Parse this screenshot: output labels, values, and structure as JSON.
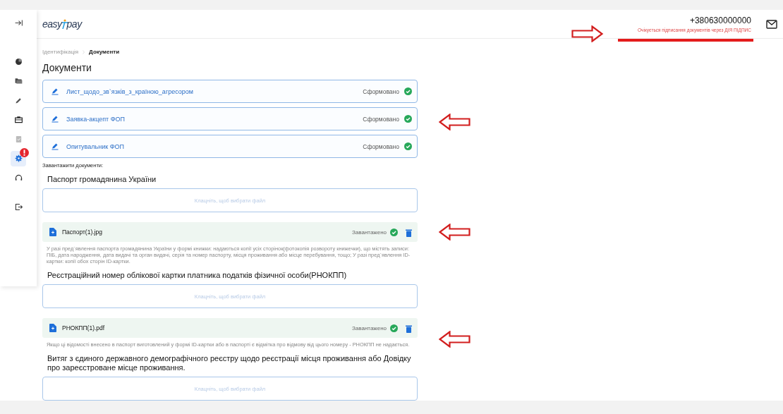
{
  "sidebar": {
    "items": [
      {
        "kind": "collapse",
        "selected": false,
        "alert": false
      },
      {
        "kind": "chart",
        "selected": false,
        "alert": false
      },
      {
        "kind": "folders",
        "selected": false,
        "alert": false
      },
      {
        "kind": "pen",
        "selected": false,
        "alert": false
      },
      {
        "kind": "briefcase",
        "selected": false,
        "alert": false
      },
      {
        "kind": "clipboard",
        "selected": false,
        "alert": false
      },
      {
        "kind": "gear",
        "selected": true,
        "alert": true
      },
      {
        "kind": "headset",
        "selected": false,
        "alert": false
      },
      {
        "kind": "logout",
        "selected": false,
        "alert": false
      }
    ]
  },
  "header": {
    "logo": [
      "easy",
      "pay"
    ],
    "phone": "+380630000000",
    "notice": "Очікується підписання документів через ДІЯ ПІДПИС"
  },
  "breadcrumbs": [
    {
      "label": "Ідентифікація",
      "selected": false
    },
    {
      "label": "Документи",
      "selected": true
    }
  ],
  "title": "Документи",
  "documents": [
    {
      "name": "Лист_щодо_зв`язків_з_країною_агресором",
      "status": "Сформовано",
      "done": true
    },
    {
      "name": "Заявка-акцепт ФОП",
      "status": "Сформовано",
      "done": true
    },
    {
      "name": "Опитувальник ФОП",
      "status": "Сформовано",
      "done": true
    }
  ],
  "uploads_label": "Завантажити документи:",
  "uploads": [
    {
      "title": "Паспорт громадянина України",
      "placeholder": "Клацніть, щоб вибрати файл",
      "file": {
        "name": "Паспорт(1).jpg",
        "status": "Завантажено",
        "done": true
      },
      "hint": "У разі пред`явлення паспорта громадянина України у формі книжки: надаються копії усіх сторінок(фотокопія розвороту книжечки), що містять записи: ПІБ, дата народження, дата видачі та орган видачі, серія та номер паспорту, місця проживання або місце перебування, тощо; У разі пред`явлення ID-картки: копії обох сторін ID-картки."
    },
    {
      "title": "Реєстраційний номер облікової картки платника податків фізичної особи(РНОКПП)",
      "placeholder": "Клацніть, щоб вибрати файл",
      "file": {
        "name": "РНОКПП(1).pdf",
        "status": "Завантажено",
        "done": true
      },
      "hint": "Якщо ці відомості внесено в паспорт виготовлений у формі ID-картки або в паспорті є відмітка про відмову від цього номеру - РНОКПП не надається."
    },
    {
      "title": "Витяг з єдиного державного демографічного реєстру щодо реєстрації місця проживання або Довідку про зареєстроване місце проживання.",
      "placeholder": "Клацніть, щоб вибрати файл"
    }
  ]
}
